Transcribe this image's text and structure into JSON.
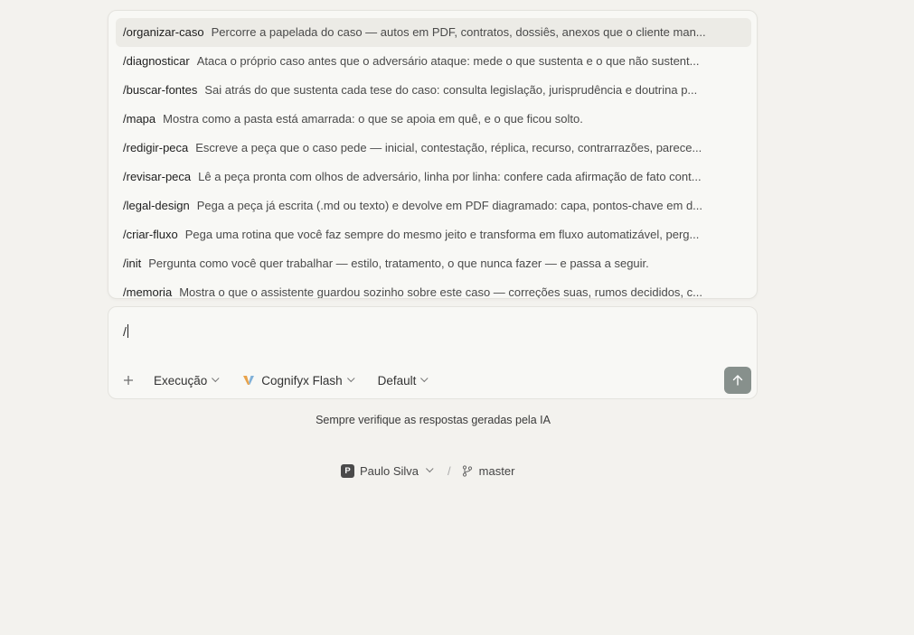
{
  "commands": [
    {
      "name": "/organizar-caso",
      "desc": "Percorre a papelada do caso — autos em PDF, contratos, dossiês, anexos que o cliente man...",
      "active": true
    },
    {
      "name": "/diagnosticar",
      "desc": "Ataca o próprio caso antes que o adversário ataque: mede o que sustenta e o que não sustent..."
    },
    {
      "name": "/buscar-fontes",
      "desc": "Sai atrás do que sustenta cada tese do caso: consulta legislação, jurisprudência e doutrina p..."
    },
    {
      "name": "/mapa",
      "desc": "Mostra como a pasta está amarrada: o que se apoia em quê, e o que ficou solto."
    },
    {
      "name": "/redigir-peca",
      "desc": "Escreve a peça que o caso pede — inicial, contestação, réplica, recurso, contrarrazões, parece..."
    },
    {
      "name": "/revisar-peca",
      "desc": "Lê a peça pronta com olhos de adversário, linha por linha: confere cada afirmação de fato cont..."
    },
    {
      "name": "/legal-design",
      "desc": "Pega a peça já escrita (.md ou texto) e devolve em PDF diagramado: capa, pontos-chave em d..."
    },
    {
      "name": "/criar-fluxo",
      "desc": "Pega uma rotina que você faz sempre do mesmo jeito e transforma em fluxo automatizável, perg..."
    },
    {
      "name": "/init",
      "desc": "Pergunta como você quer trabalhar — estilo, tratamento, o que nunca fazer — e passa a seguir."
    },
    {
      "name": "/memoria",
      "desc": "Mostra o que o assistente guardou sozinho sobre este caso — correções suas, rumos decididos, c..."
    }
  ],
  "composer": {
    "value": "/",
    "mode_label": "Execução",
    "model_label": "Cognifyx Flash",
    "profile_label": "Default"
  },
  "disclaimer": "Sempre verifique as respostas geradas pela IA",
  "footer": {
    "avatar_initial": "P",
    "user_name": "Paulo Silva",
    "separator": "/",
    "branch": "master"
  },
  "colors": {
    "background": "#f3f2ee",
    "send_button": "#87908c",
    "model_logo_left": "#e8a24a",
    "model_logo_right": "#7fb0d8"
  },
  "icons": {
    "attach": "plus-icon",
    "send": "arrow-up-icon",
    "branch": "git-branch-icon"
  }
}
